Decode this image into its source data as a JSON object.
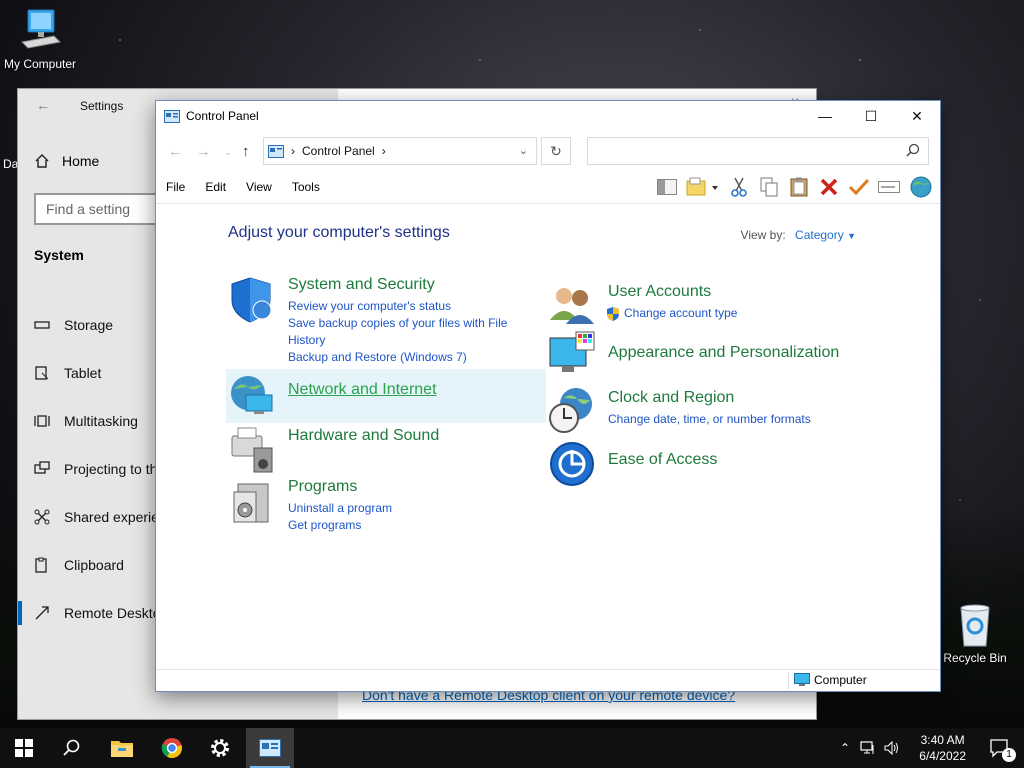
{
  "desktop": {
    "icons": [
      {
        "label": "My Computer"
      },
      {
        "label": "Recycle Bin"
      }
    ],
    "edge_text": "Da"
  },
  "settings": {
    "title": "Settings",
    "home": "Home",
    "search_placeholder": "Find a setting",
    "section": "System",
    "nav": [
      {
        "label": "Storage",
        "icon": "storage-icon"
      },
      {
        "label": "Tablet",
        "icon": "tablet-icon"
      },
      {
        "label": "Multitasking",
        "icon": "multitasking-icon"
      },
      {
        "label": "Projecting to th",
        "icon": "projecting-icon"
      },
      {
        "label": "Shared experie",
        "icon": "shared-icon"
      },
      {
        "label": "Clipboard",
        "icon": "clipboard-icon"
      },
      {
        "label": "Remote Deskto",
        "icon": "remote-desktop-icon"
      }
    ],
    "footer_link": "Don't have a Remote Desktop client on your remote device?"
  },
  "control_panel": {
    "title": "Control Panel",
    "breadcrumb": "Control Panel",
    "search_placeholder": "",
    "menu": [
      "File",
      "Edit",
      "View",
      "Tools"
    ],
    "heading": "Adjust your computer's settings",
    "view_by_label": "View by:",
    "view_by_value": "Category",
    "categories_left": [
      {
        "title": "System and Security",
        "links": [
          "Review your computer's status",
          "Save backup copies of your files with File History",
          "Backup and Restore (Windows 7)"
        ]
      },
      {
        "title": "Network and Internet",
        "links": []
      },
      {
        "title": "Hardware and Sound",
        "links": []
      },
      {
        "title": "Programs",
        "links": [
          "Uninstall a program",
          "Get programs"
        ]
      }
    ],
    "categories_right": [
      {
        "title": "User Accounts",
        "links": [
          "Change account type"
        ]
      },
      {
        "title": "Appearance and Personalization",
        "links": []
      },
      {
        "title": "Clock and Region",
        "links": [
          "Change date, time, or number formats"
        ]
      },
      {
        "title": "Ease of Access",
        "links": []
      }
    ],
    "status_item": "Computer"
  },
  "taskbar": {
    "time": "3:40 AM",
    "date": "6/4/2022",
    "notification_count": "1"
  },
  "colors": {
    "category_title": "#1e7a3c",
    "link": "#1e55c8",
    "heading": "#1e3287",
    "accent": "#0067c0"
  }
}
